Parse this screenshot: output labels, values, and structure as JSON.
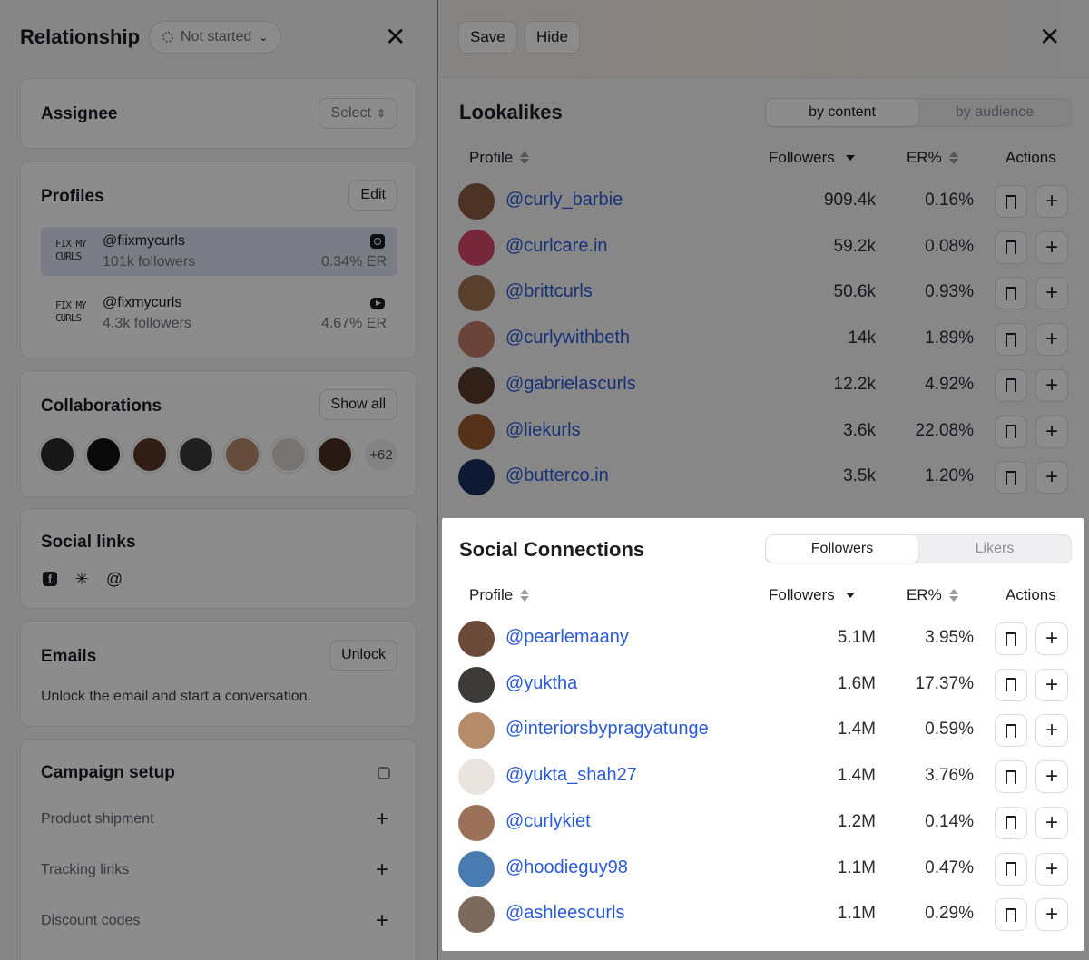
{
  "left": {
    "title": "Relationship",
    "status": "Not started",
    "assignee": {
      "title": "Assignee",
      "select_label": "Select"
    },
    "profiles": {
      "title": "Profiles",
      "edit_label": "Edit",
      "items": [
        {
          "logo": "FIX MY CURLS",
          "handle": "@fiixmycurls",
          "followers": "101k followers",
          "er": "0.34% ER",
          "platform": "instagram-icon"
        },
        {
          "logo": "FIX MY CURLS",
          "handle": "@fixmycurls",
          "followers": "4.3k followers",
          "er": "4.67% ER",
          "platform": "youtube-icon"
        }
      ]
    },
    "collaborations": {
      "title": "Collaborations",
      "show_all_label": "Show all",
      "more_count": "+62"
    },
    "social_links": {
      "title": "Social links"
    },
    "emails": {
      "title": "Emails",
      "unlock_label": "Unlock",
      "text": "Unlock the email and start a conversation."
    },
    "campaign": {
      "title": "Campaign setup",
      "items": [
        "Product shipment",
        "Tracking links",
        "Discount codes"
      ]
    }
  },
  "right": {
    "save_label": "Save",
    "hide_label": "Hide",
    "lookalikes": {
      "title": "Lookalikes",
      "tabs": [
        "by content",
        "by audience"
      ],
      "headers": {
        "profile": "Profile",
        "followers": "Followers",
        "er": "ER%",
        "actions": "Actions"
      },
      "rows": [
        {
          "handle": "@curly_barbie",
          "followers": "909.4k",
          "er": "0.16%",
          "color": "#8a5a44"
        },
        {
          "handle": "@curlcare.in",
          "followers": "59.2k",
          "er": "0.08%",
          "color": "#d9476b"
        },
        {
          "handle": "@brittcurls",
          "followers": "50.6k",
          "er": "0.93%",
          "color": "#a27355"
        },
        {
          "handle": "@curlywithbeth",
          "followers": "14k",
          "er": "1.89%",
          "color": "#c27d69"
        },
        {
          "handle": "@gabrielascurls",
          "followers": "12.2k",
          "er": "4.92%",
          "color": "#5a3b2c"
        },
        {
          "handle": "@liekurls",
          "followers": "3.6k",
          "er": "22.08%",
          "color": "#9a5a2f"
        },
        {
          "handle": "@butterco.in",
          "followers": "3.5k",
          "er": "1.20%",
          "color": "#1b2e5e"
        }
      ]
    },
    "social_connections": {
      "title": "Social Connections",
      "tabs": [
        "Followers",
        "Likers"
      ],
      "headers": {
        "profile": "Profile",
        "followers": "Followers",
        "er": "ER%",
        "actions": "Actions"
      },
      "rows": [
        {
          "handle": "@pearlemaany",
          "followers": "5.1M",
          "er": "3.95%",
          "color": "#6b4a3a"
        },
        {
          "handle": "@yuktha",
          "followers": "1.6M",
          "er": "17.37%",
          "color": "#3d3a3a"
        },
        {
          "handle": "@interiorsbypragyatunge",
          "followers": "1.4M",
          "er": "0.59%",
          "color": "#b58b6a"
        },
        {
          "handle": "@yukta_shah27",
          "followers": "1.4M",
          "er": "3.76%",
          "color": "#e9e4e0"
        },
        {
          "handle": "@curlykiet",
          "followers": "1.2M",
          "er": "0.14%",
          "color": "#9b7059"
        },
        {
          "handle": "@hoodieguy98",
          "followers": "1.1M",
          "er": "0.47%",
          "color": "#4a7bb0"
        },
        {
          "handle": "@ashleescurls",
          "followers": "1.1M",
          "er": "0.29%",
          "color": "#7c6a5e"
        }
      ]
    }
  }
}
